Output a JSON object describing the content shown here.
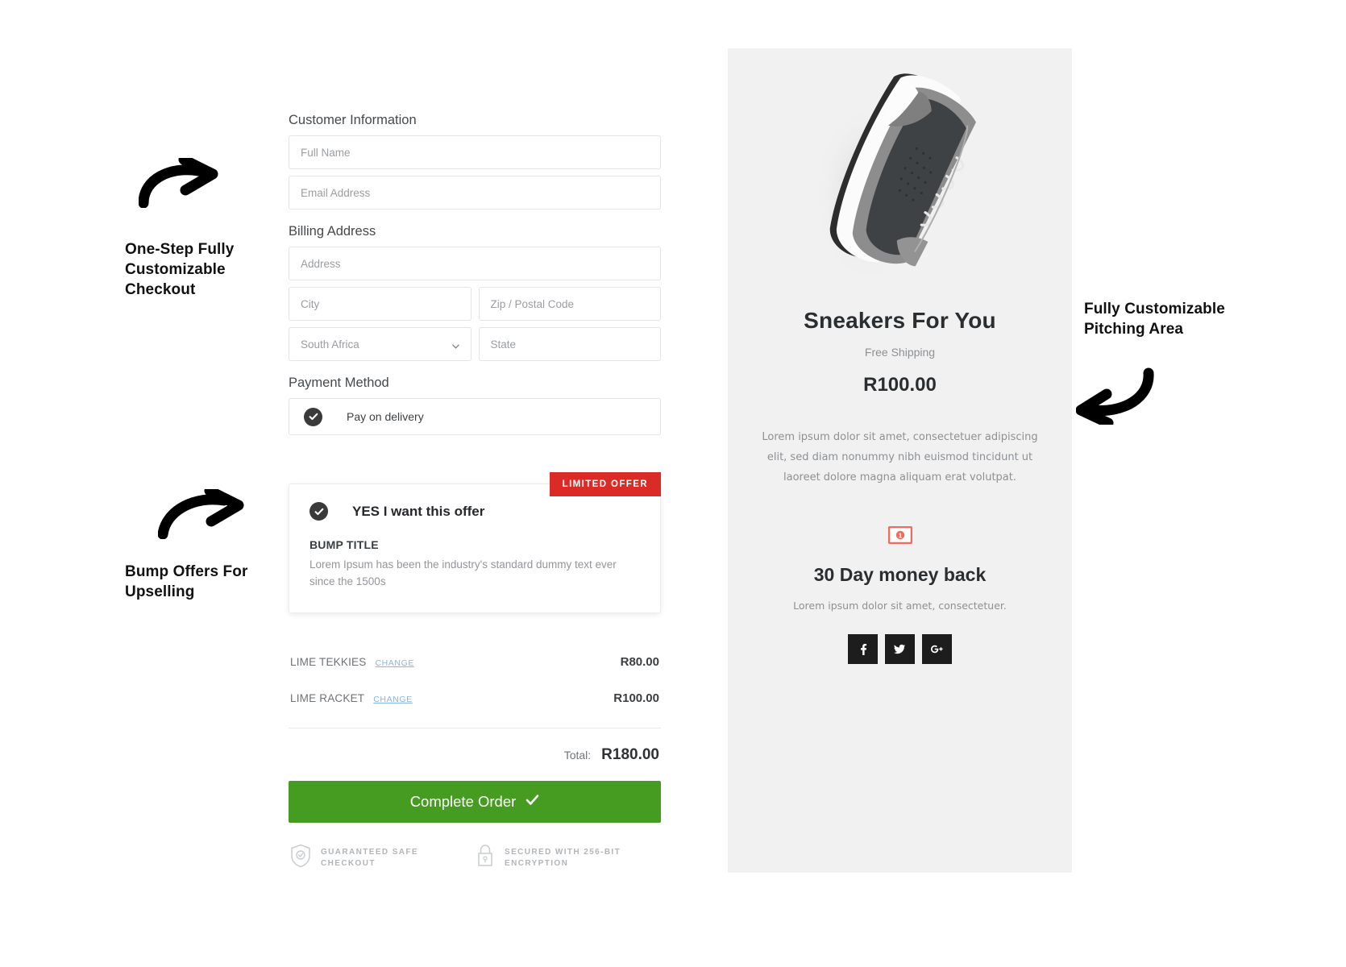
{
  "annotations": [
    {
      "id": "checkout-annotation",
      "text": "One-Step Fully\nCustomizable\nCheckout",
      "arrow": "curved-arrow-right"
    },
    {
      "id": "bump-annotation",
      "text": "Bump Offers For\nUpselling",
      "arrow": "curved-arrow-right"
    },
    {
      "id": "pitch-annotation",
      "text": "Fully Customizable\nPitching Area",
      "arrow": "curved-arrow-left"
    }
  ],
  "checkout": {
    "customer_section_title": "Customer Information",
    "fields": {
      "full_name_placeholder": "Full Name",
      "email_placeholder": "Email Address"
    },
    "billing_section_title": "Billing Address",
    "billing": {
      "address_placeholder": "Address",
      "city_placeholder": "City",
      "zip_placeholder": "Zip / Postal Code",
      "country_selected": "South Africa",
      "state_placeholder": "State"
    },
    "payment_section_title": "Payment Method",
    "payment": {
      "selected_method": "Pay on delivery",
      "radio_state": "selected"
    },
    "bump": {
      "badge": "LIMITED OFFER",
      "checkbox_label": "YES I want this offer",
      "checkbox_state": "checked",
      "title": "BUMP TITLE",
      "description": "Lorem Ipsum has been the industry's standard dummy text ever since the 1500s"
    },
    "line_items": [
      {
        "name": "LIME TEKKIES",
        "change_label": "CHANGE",
        "price": "R80.00"
      },
      {
        "name": "LIME RACKET",
        "change_label": "CHANGE",
        "price": "R100.00"
      }
    ],
    "total_label": "Total:",
    "total_value": "R180.00",
    "cta_label": "Complete Order",
    "cta_icon": "checkmark-icon",
    "cta_color": "#469b21",
    "trust_badges": [
      {
        "icon": "shield-check-icon",
        "text": "GUARANTEED SAFE\nCHECKOUT"
      },
      {
        "icon": "lock-icon",
        "text": "SECURED WITH 256-BIT\nENCRYPTION"
      }
    ]
  },
  "pitch": {
    "product_image": "sneaker-photo",
    "title": "Sneakers For You",
    "shipping": "Free Shipping",
    "price": "R100.00",
    "description": "Lorem ipsum dolor sit amet, consectetuer adipiscing elit, sed diam nonummy nibh euismod tincidunt ut laoreet dolore magna aliquam erat volutpat.",
    "guarantee_icon": "money-bill-icon",
    "guarantee_icon_color": "#ef6d5a",
    "guarantee_title": "30 Day money back",
    "guarantee_text": "Lorem ipsum dolor sit amet, consectetuer.",
    "socials": [
      {
        "name": "facebook-icon",
        "label": "f"
      },
      {
        "name": "twitter-icon",
        "label": "t"
      },
      {
        "name": "google-plus-icon",
        "label": "G+"
      }
    ],
    "background": "#f1f1f1"
  }
}
